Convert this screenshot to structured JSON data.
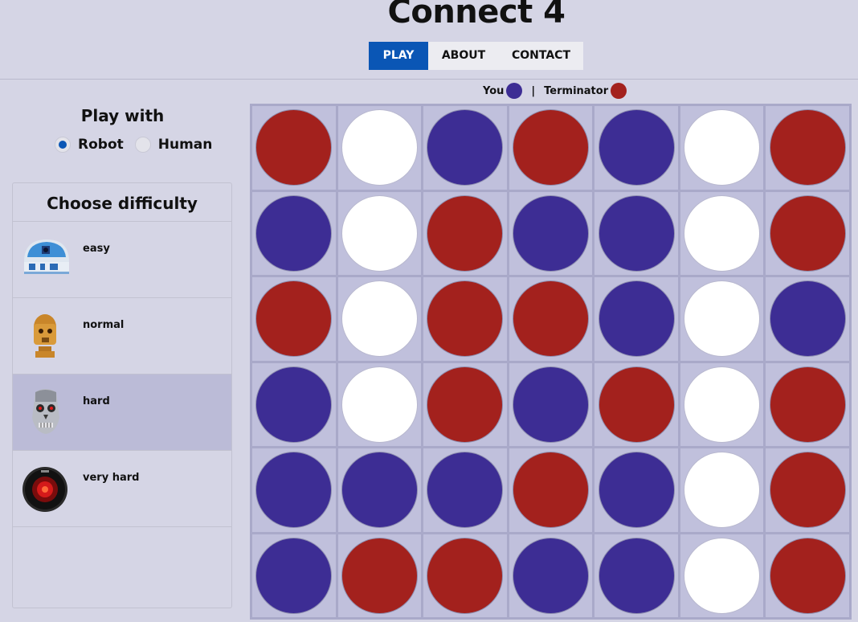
{
  "header": {
    "title": "Connect 4",
    "tabs": [
      {
        "label": "PLAY",
        "active": true
      },
      {
        "label": "ABOUT",
        "active": false
      },
      {
        "label": "CONTACT",
        "active": false
      }
    ]
  },
  "legend": {
    "you_label": "You",
    "separator": "|",
    "opponent_label": "Terminator",
    "you_color": "#3d2d94",
    "opponent_color": "#a3211d"
  },
  "play_with": {
    "title": "Play with",
    "options": [
      {
        "label": "Robot",
        "selected": true
      },
      {
        "label": "Human",
        "selected": false
      }
    ]
  },
  "difficulty": {
    "title": "Choose difficulty",
    "levels": [
      {
        "label": "easy",
        "avatar": "r2d2-robot-icon",
        "selected": false
      },
      {
        "label": "normal",
        "avatar": "c3po-robot-icon",
        "selected": false
      },
      {
        "label": "hard",
        "avatar": "terminator-skull-icon",
        "selected": true
      },
      {
        "label": "very hard",
        "avatar": "hal9000-eye-icon",
        "selected": false
      }
    ]
  },
  "board": {
    "rows": 6,
    "cols": 7,
    "cells": [
      [
        "ai",
        "empty",
        "you",
        "ai",
        "you",
        "empty",
        "ai"
      ],
      [
        "you",
        "empty",
        "ai",
        "you",
        "you",
        "empty",
        "ai"
      ],
      [
        "ai",
        "empty",
        "ai",
        "ai",
        "you",
        "empty",
        "you"
      ],
      [
        "you",
        "empty",
        "ai",
        "you",
        "ai",
        "empty",
        "ai"
      ],
      [
        "you",
        "you",
        "you",
        "ai",
        "you",
        "empty",
        "ai"
      ],
      [
        "you",
        "ai",
        "ai",
        "you",
        "you",
        "empty",
        "ai"
      ]
    ]
  }
}
